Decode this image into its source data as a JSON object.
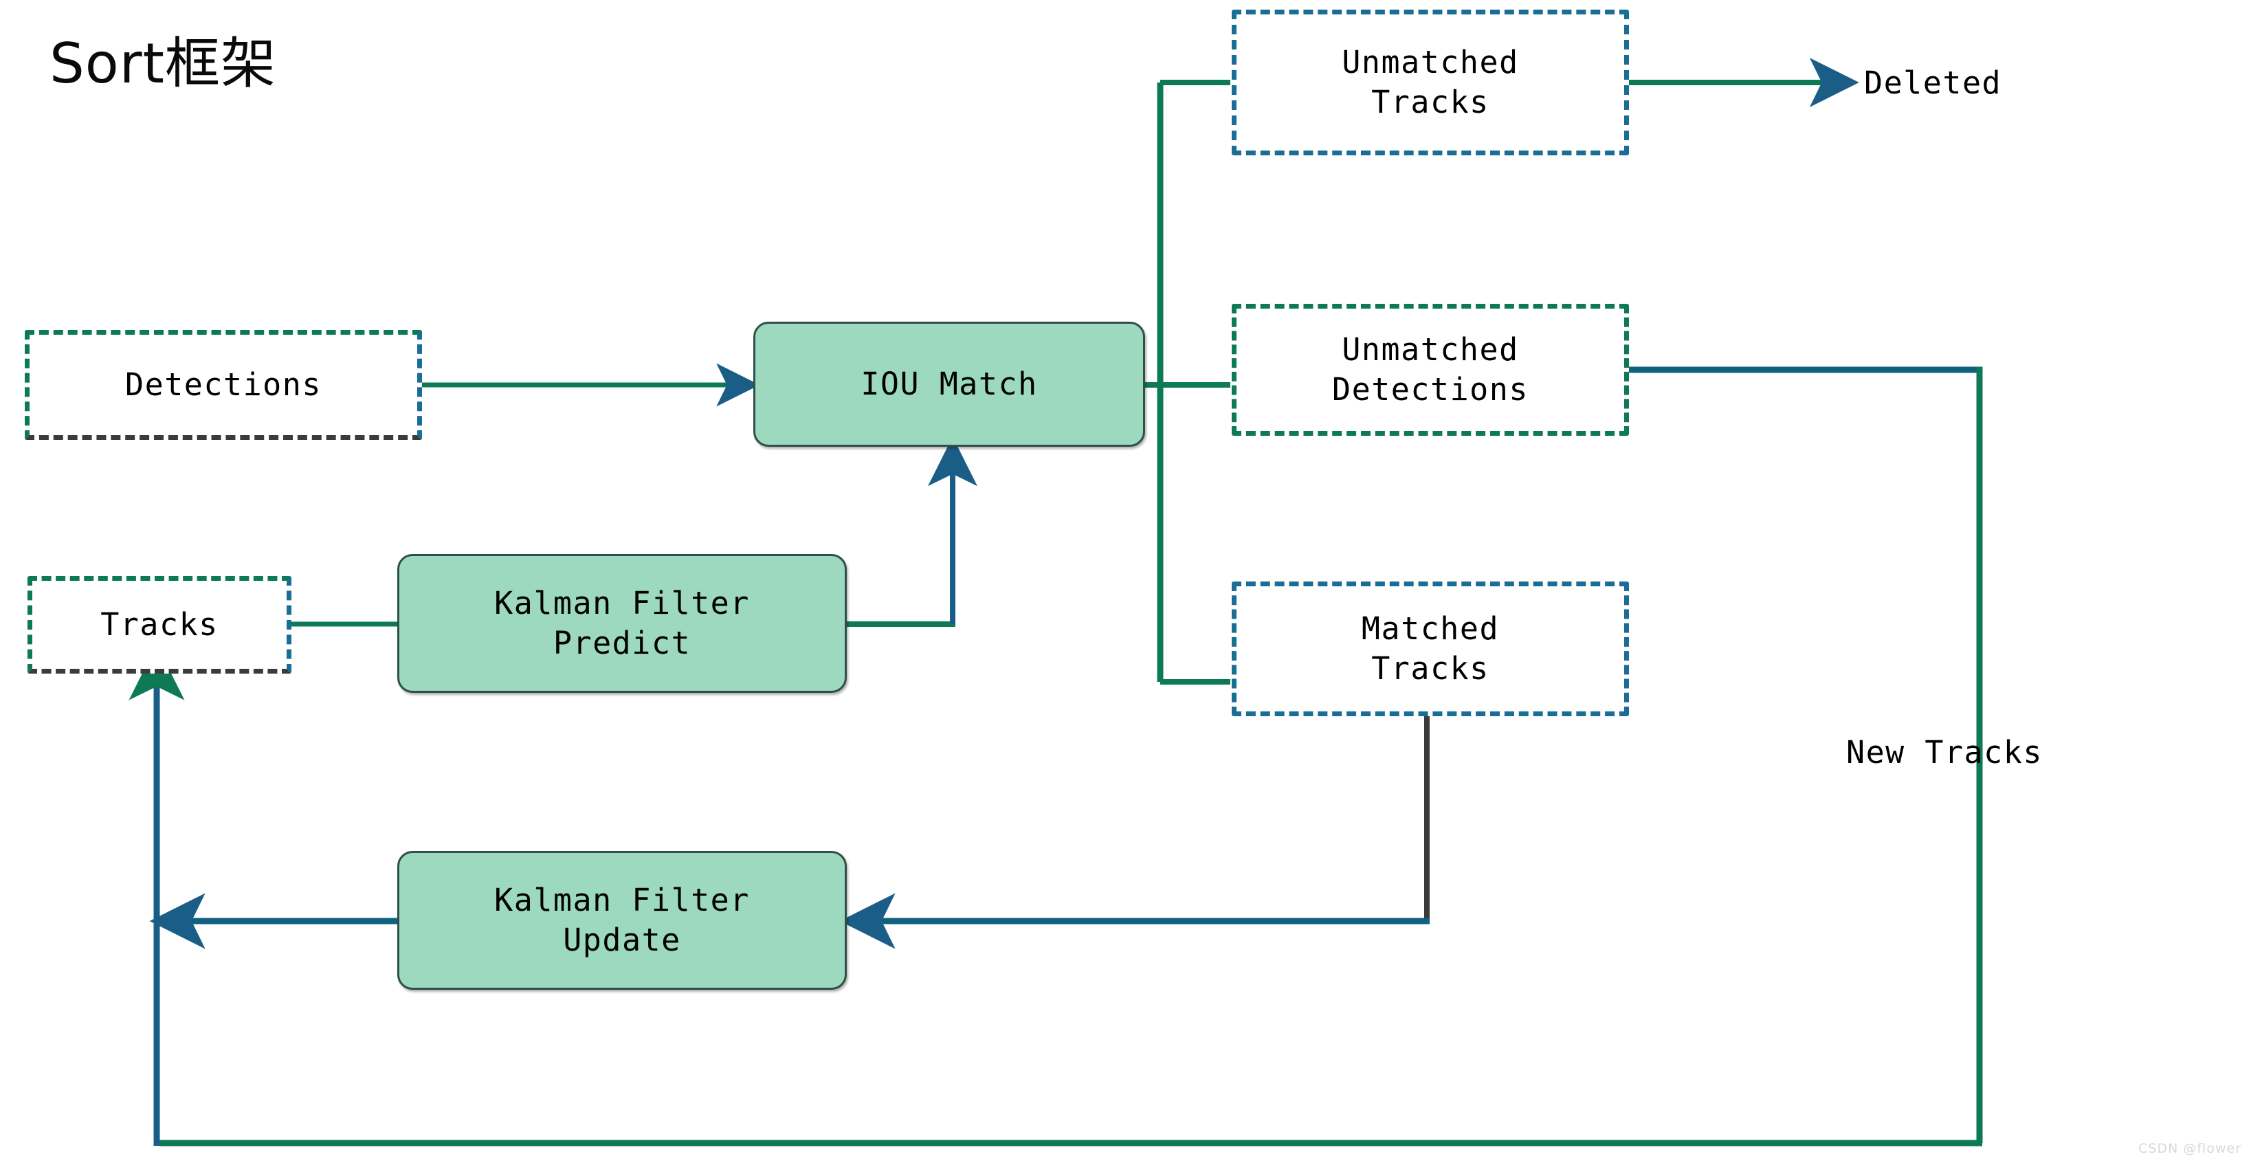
{
  "page": {
    "title": "Sort框架",
    "background_color": "#ffffff",
    "watermark": "CSDN @flower"
  },
  "palette": {
    "process_fill": "#9cd9bf",
    "process_border": "#2f4f49",
    "dashed_teal": "#0d7a55",
    "dashed_blue": "#1a6d96",
    "wire_green": "#0d7a55",
    "wire_blue": "#1a6d96",
    "text": "#000000"
  },
  "nodes": {
    "detections": {
      "label": "Detections",
      "kind": "dashed-box"
    },
    "tracks": {
      "label": "Tracks",
      "kind": "dashed-box"
    },
    "iou_match": {
      "label": "IOU Match",
      "kind": "process-box"
    },
    "kalman_predict": {
      "label": "Kalman Filter\nPredict",
      "kind": "process-box"
    },
    "kalman_update": {
      "label": "Kalman Filter\nUpdate",
      "kind": "process-box"
    },
    "unmatched_tracks": {
      "label": "Unmatched\nTracks",
      "kind": "dashed-box"
    },
    "unmatched_detections": {
      "label": "Unmatched\nDetections",
      "kind": "dashed-box"
    },
    "matched_tracks": {
      "label": "Matched\nTracks",
      "kind": "dashed-box"
    }
  },
  "labels": {
    "deleted": "Deleted",
    "new_tracks": "New Tracks"
  },
  "edges": [
    {
      "name": "detections-to-iou-match",
      "from": "detections",
      "to": "iou_match"
    },
    {
      "name": "tracks-to-kalman-predict",
      "from": "tracks",
      "to": "kalman_predict"
    },
    {
      "name": "kalman-predict-to-iou-match",
      "from": "kalman_predict",
      "to": "iou_match"
    },
    {
      "name": "iou-match-to-unmatched-tracks",
      "from": "iou_match",
      "to": "unmatched_tracks"
    },
    {
      "name": "iou-match-to-unmatched-detections",
      "from": "iou_match",
      "to": "unmatched_detections"
    },
    {
      "name": "iou-match-to-matched-tracks",
      "from": "iou_match",
      "to": "matched_tracks"
    },
    {
      "name": "unmatched-tracks-to-deleted",
      "from": "unmatched_tracks",
      "to": "deleted"
    },
    {
      "name": "unmatched-detections-to-new-tracks",
      "from": "unmatched_detections",
      "to": "new_tracks"
    },
    {
      "name": "matched-tracks-to-kalman-update",
      "from": "matched_tracks",
      "to": "kalman_update"
    },
    {
      "name": "kalman-update-to-tracks",
      "from": "kalman_update",
      "to": "tracks"
    },
    {
      "name": "new-tracks-to-tracks",
      "from": "new_tracks",
      "to": "tracks"
    }
  ]
}
